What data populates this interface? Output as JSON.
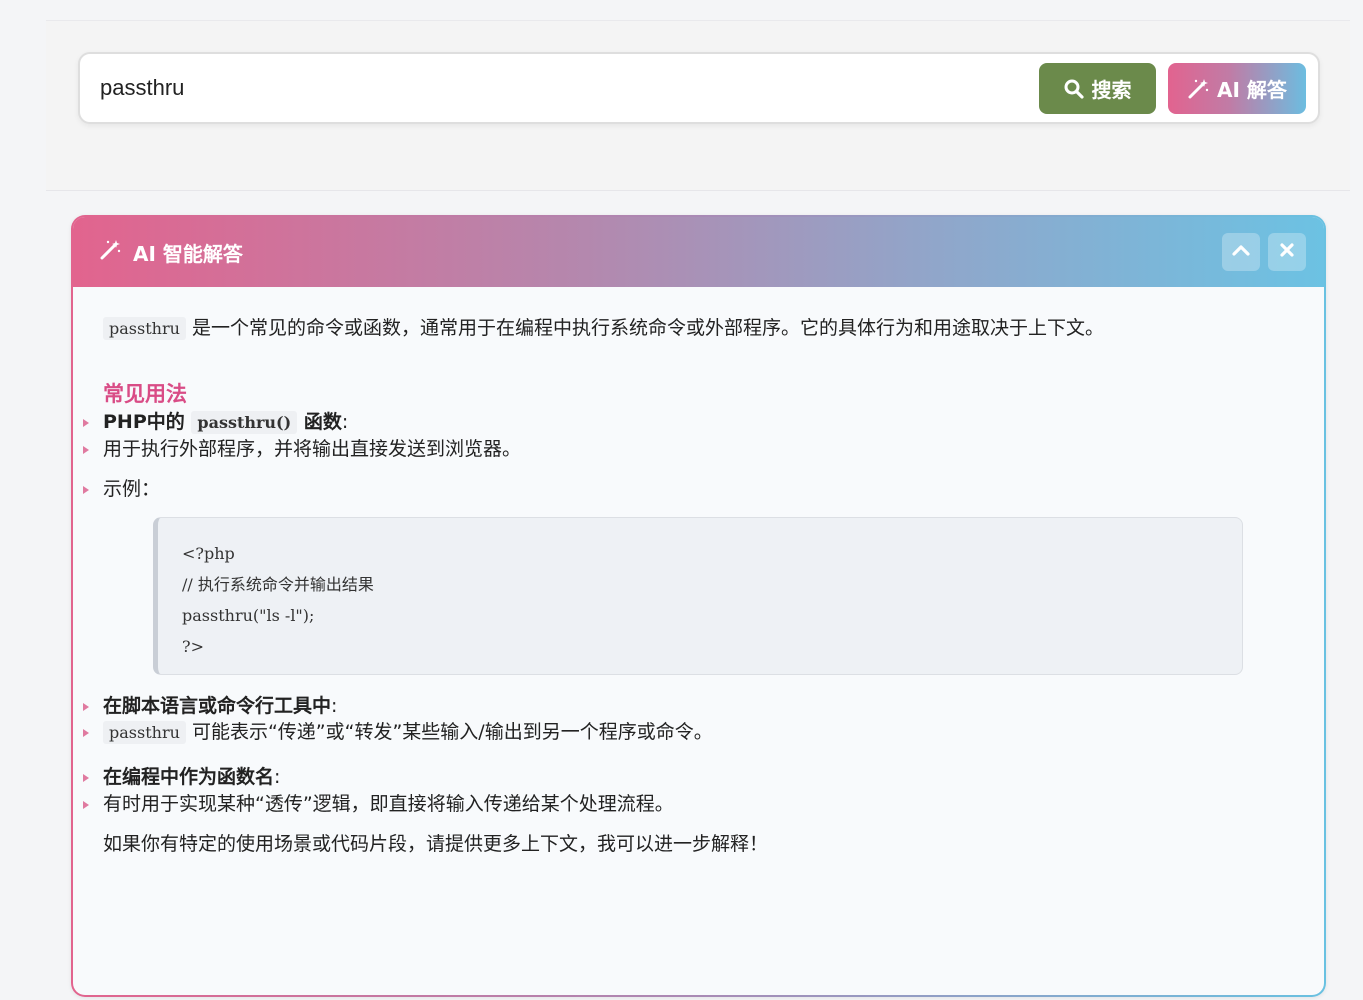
{
  "search": {
    "value": "passthru",
    "search_button_label": "搜索",
    "ai_button_label": "AI 解答"
  },
  "ai_panel": {
    "title": "AI 智能解答",
    "intro_code": "passthru",
    "intro_text": "是一个常见的命令或函数，通常用于在编程中执行系统命令或外部程序。它的具体行为和用途取决于上下文。",
    "section_title": "常见用法",
    "items": [
      {
        "label_prefix": "PHP中的",
        "label_code": "passthru()",
        "label_suffix": "函数",
        "colon": ":",
        "subitems": [
          "用于执行外部程序，并将输出直接发送到浏览器。",
          "示例："
        ],
        "code_lines": [
          "<?php",
          "// 执行系统命令并输出结果",
          "passthru(\"ls -l\");",
          "?>"
        ]
      },
      {
        "label": "在脚本语言或命令行工具中",
        "colon": ":",
        "sub_code": "passthru",
        "sub_text": "可能表示“传递”或“转发”某些输入/输出到另一个程序或命令。"
      },
      {
        "label": "在编程中作为函数名",
        "colon": ":",
        "sub_text": "有时用于实现某种“透传”逻辑，即直接将输入传递给某个处理流程。"
      }
    ],
    "outro": "如果你有特定的使用场景或代码片段，请提供更多上下文，我可以进一步解释！"
  },
  "colors": {
    "search_button": "#6b8a4b",
    "gradient_start": "#e2648e",
    "gradient_end": "#6cc2e3",
    "section_title": "#d94c86"
  },
  "icons": {
    "search_button": "search-icon",
    "ai_button": "magic-wand-icon",
    "panel_title": "magic-wand-icon",
    "collapse": "chevron-up-icon",
    "close": "close-icon"
  }
}
